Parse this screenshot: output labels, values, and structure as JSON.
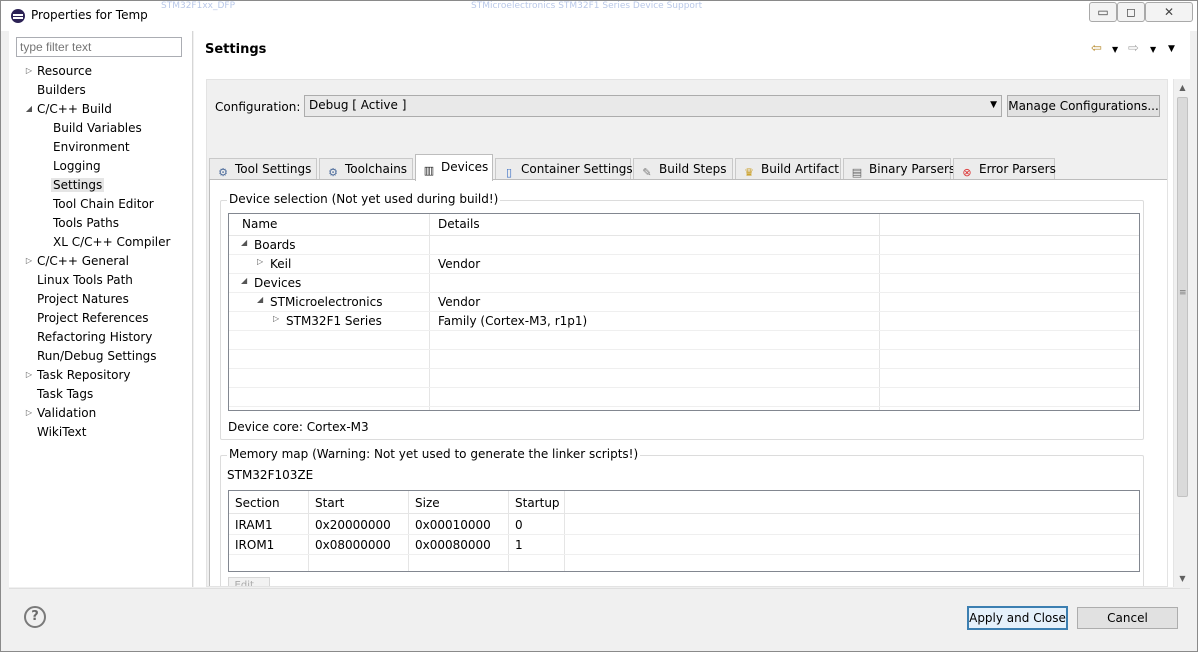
{
  "window": {
    "title": "Properties for Temp",
    "ghost_texts": [
      "STM32F1xx_DFP",
      "STMicroelectronics STM32F1 Series Device Support"
    ],
    "controls": {
      "minimize": "▭",
      "maximize": "◻",
      "close": "✕"
    }
  },
  "left": {
    "filter_placeholder": "type filter text",
    "tree": [
      {
        "label": "Resource",
        "level": 0,
        "arrow": "▷"
      },
      {
        "label": "Builders",
        "level": 0,
        "arrow": ""
      },
      {
        "label": "C/C++ Build",
        "level": 0,
        "arrow": "◢"
      },
      {
        "label": "Build Variables",
        "level": 1,
        "arrow": ""
      },
      {
        "label": "Environment",
        "level": 1,
        "arrow": ""
      },
      {
        "label": "Logging",
        "level": 1,
        "arrow": ""
      },
      {
        "label": "Settings",
        "level": 1,
        "arrow": "",
        "selected": true
      },
      {
        "label": "Tool Chain Editor",
        "level": 1,
        "arrow": ""
      },
      {
        "label": "Tools Paths",
        "level": 1,
        "arrow": ""
      },
      {
        "label": "XL C/C++ Compiler",
        "level": 1,
        "arrow": ""
      },
      {
        "label": "C/C++ General",
        "level": 0,
        "arrow": "▷"
      },
      {
        "label": "Linux Tools Path",
        "level": 0,
        "arrow": ""
      },
      {
        "label": "Project Natures",
        "level": 0,
        "arrow": ""
      },
      {
        "label": "Project References",
        "level": 0,
        "arrow": ""
      },
      {
        "label": "Refactoring History",
        "level": 0,
        "arrow": ""
      },
      {
        "label": "Run/Debug Settings",
        "level": 0,
        "arrow": ""
      },
      {
        "label": "Task Repository",
        "level": 0,
        "arrow": "▷"
      },
      {
        "label": "Task Tags",
        "level": 0,
        "arrow": ""
      },
      {
        "label": "Validation",
        "level": 0,
        "arrow": "▷"
      },
      {
        "label": "WikiText",
        "level": 0,
        "arrow": ""
      }
    ]
  },
  "right": {
    "title": "Settings",
    "nav_icons": [
      "back-arrow-icon",
      "dropdown-icon",
      "forward-arrow-icon",
      "dropdown-icon",
      "view-menu-icon"
    ],
    "configuration_label": "Configuration:",
    "configuration_value": "Debug  [ Active ]",
    "manage_button": "Manage Configurations...",
    "tabs": [
      {
        "label": "Tool Settings",
        "icon": "⚙",
        "icon_name": "tool-settings-icon"
      },
      {
        "label": "Toolchains",
        "icon": "⚙",
        "icon_name": "toolchains-icon"
      },
      {
        "label": "Devices",
        "icon": "▥",
        "icon_name": "chip-icon",
        "active": true
      },
      {
        "label": "Container Settings",
        "icon": "▯",
        "icon_name": "container-icon"
      },
      {
        "label": "Build Steps",
        "icon": "✎",
        "icon_name": "build-steps-icon"
      },
      {
        "label": "Build Artifact",
        "icon": "♛",
        "icon_name": "build-artifact-icon"
      },
      {
        "label": "Binary Parsers",
        "icon": "▤",
        "icon_name": "binary-parsers-icon"
      },
      {
        "label": "Error Parsers",
        "icon": "⊗",
        "icon_name": "error-parsers-icon"
      }
    ],
    "device_group_title": "Device selection (Not yet used during build!)",
    "device_columns": [
      "Name",
      "Details"
    ],
    "device_rows": [
      {
        "name": "Boards",
        "details": "",
        "indent": 0,
        "arrow": "◢"
      },
      {
        "name": "Keil",
        "details": "Vendor",
        "indent": 1,
        "arrow": "▷"
      },
      {
        "name": "Devices",
        "details": "",
        "indent": 0,
        "arrow": "◢"
      },
      {
        "name": "STMicroelectronics",
        "details": "Vendor",
        "indent": 1,
        "arrow": "◢"
      },
      {
        "name": "STM32F1 Series",
        "details": "Family (Cortex-M3, r1p1)",
        "indent": 2,
        "arrow": "▷"
      }
    ],
    "device_core_label": "Device core:",
    "device_core_value": "Cortex-M3",
    "memory_group_title": "Memory map (Warning: Not yet used to generate the linker scripts!)",
    "memory_device": "STM32F103ZE",
    "memory_columns": [
      "Section",
      "Start",
      "Size",
      "Startup"
    ],
    "memory_rows": [
      [
        "IRAM1",
        "0x20000000",
        "0x00010000",
        "0"
      ],
      [
        "IROM1",
        "0x08000000",
        "0x00080000",
        "1"
      ]
    ],
    "edit_button_partial": "Edit..."
  },
  "footer": {
    "help_icon": "?",
    "apply_close": "Apply and Close",
    "cancel": "Cancel"
  }
}
